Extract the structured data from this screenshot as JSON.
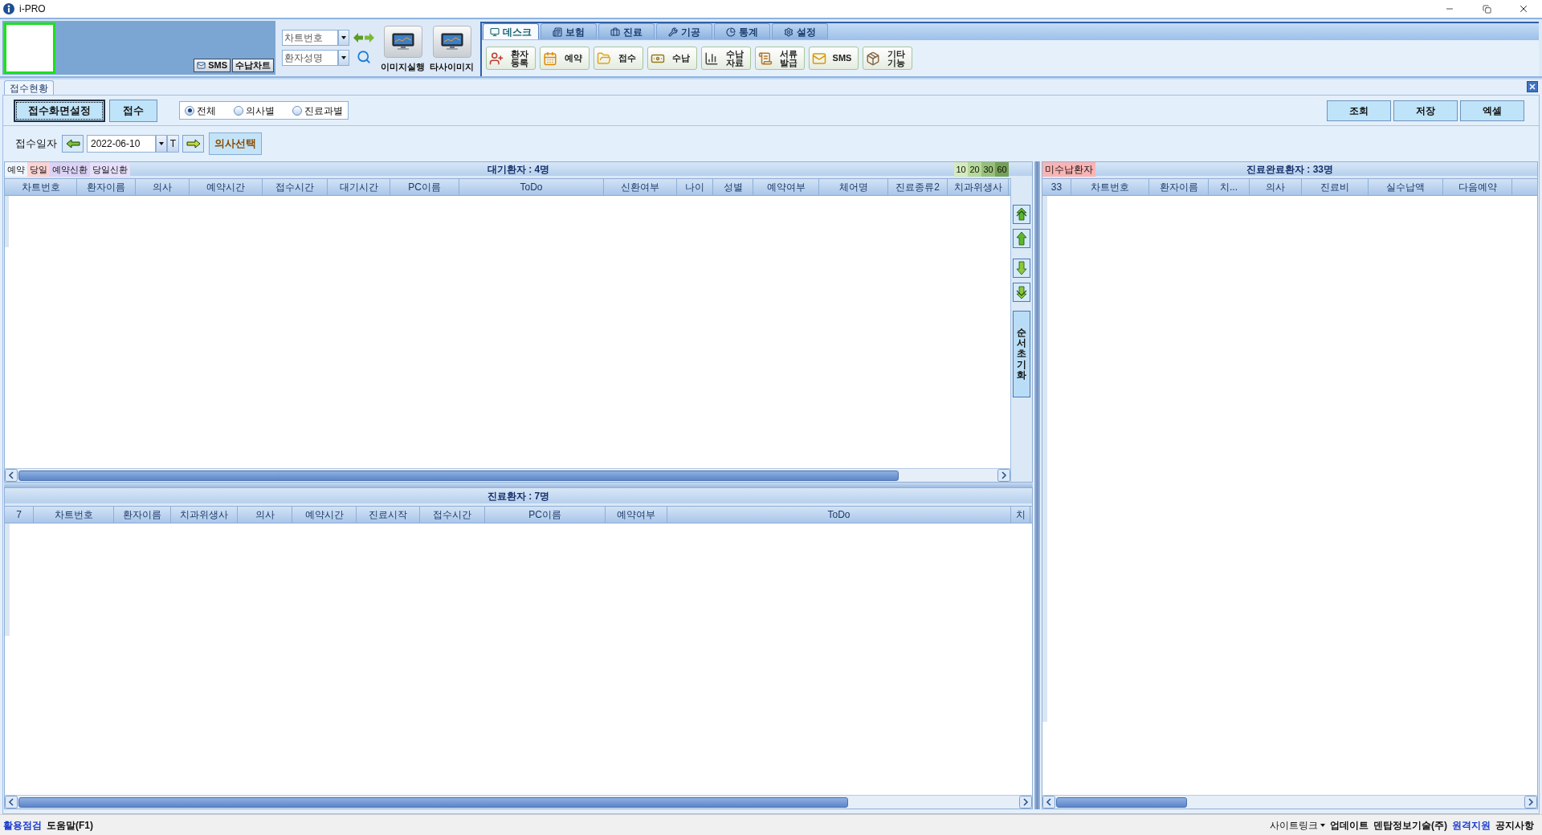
{
  "window": {
    "title": "i-PRO"
  },
  "header": {
    "photo_buttons": [
      {
        "label": "SMS"
      },
      {
        "label": "수납차트"
      }
    ],
    "lookup_fields": [
      {
        "placeholder": "차트번호"
      },
      {
        "placeholder": "환자성명"
      }
    ],
    "image_buttons": [
      {
        "label": "이미지실행"
      },
      {
        "label": "타사이미지"
      }
    ]
  },
  "tabs": [
    {
      "label": "데스크",
      "selected": true
    },
    {
      "label": "보험",
      "selected": false
    },
    {
      "label": "진료",
      "selected": false
    },
    {
      "label": "기공",
      "selected": false
    },
    {
      "label": "통계",
      "selected": false
    },
    {
      "label": "설정",
      "selected": false
    }
  ],
  "toolbar": [
    {
      "lines": [
        "환자",
        "등록"
      ]
    },
    {
      "lines": [
        "예약"
      ]
    },
    {
      "lines": [
        "접수"
      ]
    },
    {
      "lines": [
        "수납"
      ]
    },
    {
      "lines": [
        "수납",
        "자료"
      ]
    },
    {
      "lines": [
        "서류",
        "발급"
      ]
    },
    {
      "lines": [
        "SMS"
      ]
    },
    {
      "lines": [
        "기타",
        "기능"
      ]
    }
  ],
  "document_tab": {
    "label": "접수현황"
  },
  "actions": [
    {
      "label": "접수화면설정",
      "focused": true
    },
    {
      "label": "접수",
      "focused": false
    }
  ],
  "view_filter": [
    {
      "label": "전체",
      "selected": true
    },
    {
      "label": "의사별",
      "selected": false
    },
    {
      "label": "진료과별",
      "selected": false
    }
  ],
  "right_actions": [
    "조회",
    "저장",
    "엑셀"
  ],
  "date_row": {
    "label": "접수일자",
    "value": "2022-06-10",
    "today_button": "T",
    "doctor_button": "의사선택"
  },
  "waiting_panel": {
    "legend": [
      {
        "label": "예약",
        "color": "#eef5fd"
      },
      {
        "label": "당일",
        "color": "#fbd3d3"
      },
      {
        "label": "예약신환",
        "color": "#dbd2f4"
      },
      {
        "label": "당일신환",
        "color": "#e7dffa"
      }
    ],
    "title": "대기환자 : 4명",
    "wait_levels": [
      {
        "label": "10",
        "color": "#d5ebbd"
      },
      {
        "label": "20",
        "color": "#b7d99a"
      },
      {
        "label": "30",
        "color": "#97c079"
      },
      {
        "label": "60",
        "color": "#76a056"
      }
    ],
    "columns": [
      "차트번호",
      "환자이름",
      "의사",
      "예약시간",
      "접수시간",
      "대기시간",
      "PC이름",
      "ToDo",
      "신환여부",
      "나이",
      "성별",
      "예약여부",
      "체어명",
      "진료종류2",
      "치과위생사"
    ]
  },
  "order_controls": {
    "reset_button": "순서초기화"
  },
  "treatment_panel": {
    "title": "진료환자 : 7명",
    "columns": [
      "7",
      "차트번호",
      "환자이름",
      "치과위생사",
      "의사",
      "예약시간",
      "진료시작",
      "접수시간",
      "PC이름",
      "예약여부",
      "ToDo",
      "치"
    ]
  },
  "completed_panel": {
    "unpaid_tag": "미수납환자",
    "title": "진료완료환자 : 33명",
    "columns": [
      "33",
      "차트번호",
      "환자이름",
      "치...",
      "의사",
      "진료비",
      "실수납액",
      "다음예약"
    ]
  },
  "status_bar": {
    "left": [
      {
        "label": "활용점검",
        "kind": "link"
      },
      {
        "label": "도움말(F1)",
        "kind": "plain"
      }
    ],
    "right": [
      {
        "label": "사이트링크",
        "kind": "menu"
      },
      {
        "label": "업데이트",
        "kind": "plain"
      },
      {
        "label": "덴탑정보기술(주)",
        "kind": "plain"
      },
      {
        "label": "원격지원",
        "kind": "link"
      },
      {
        "label": "공지사항",
        "kind": "plain"
      }
    ]
  }
}
